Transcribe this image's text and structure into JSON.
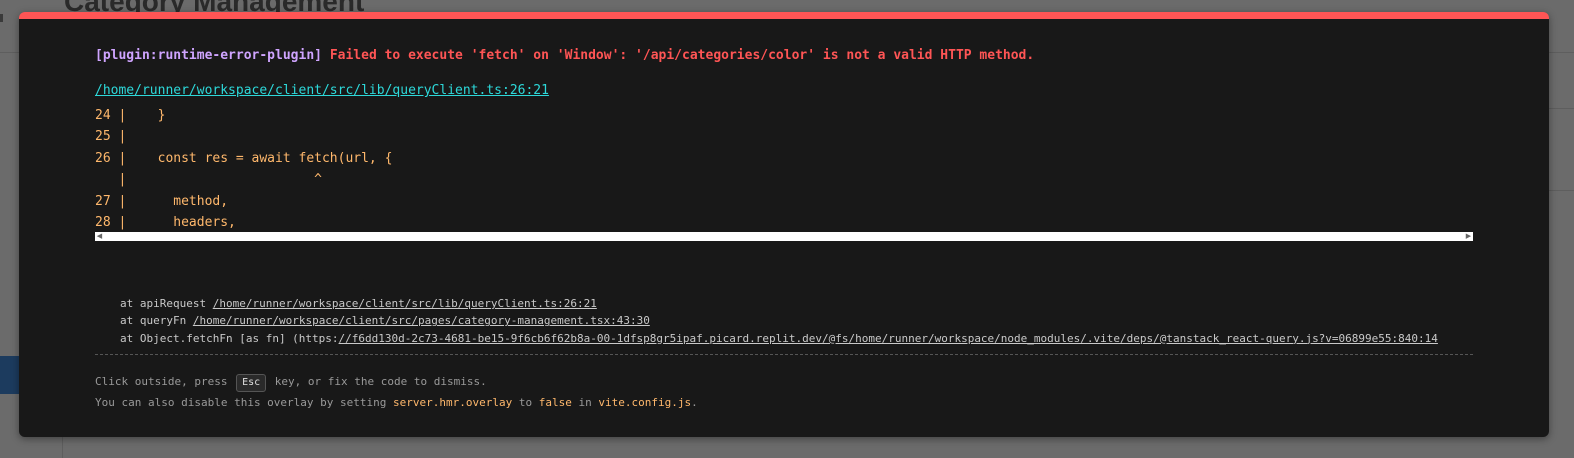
{
  "background": {
    "page_title": "Category Management"
  },
  "overlay": {
    "plugin": "[plugin:runtime-error-plugin]",
    "message": "Failed to execute 'fetch' on 'Window': '/api/categories/color' is not a valid HTTP method.",
    "file": "/home/runner/workspace/client/src/lib/queryClient.ts:26:21",
    "frame": [
      "24 |    }",
      "25 |",
      "26 |    const res = await fetch(url, {",
      "   |                        ^",
      "27 |      method,",
      "28 |      headers,"
    ],
    "stack": [
      {
        "prefix": "at apiRequest ",
        "link": "/home/runner/workspace/client/src/lib/queryClient.ts:26:21",
        "suffix": ""
      },
      {
        "prefix": "at queryFn ",
        "link": "/home/runner/workspace/client/src/pages/category-management.tsx:43:30",
        "suffix": ""
      },
      {
        "prefix": "at Object.fetchFn [as fn] (https:",
        "link": "//f6dd130d-2c73-4681-be15-9f6cb6f62b8a-00-1dfsp8gr5ipaf.picard.replit.dev/@fs/home/runner/workspace/node_modules/.vite/deps/@tanstack_react-query.js?v=06899e55:840:14",
        "suffix": ""
      }
    ],
    "tip": {
      "line1_before": "Click outside, press ",
      "key": "Esc",
      "line1_after": " key, or fix the code to dismiss.",
      "line2_a": "You can also disable this overlay by setting ",
      "line2_code1": "server.hmr.overlay",
      "line2_b": " to ",
      "line2_code2": "false",
      "line2_c": " in ",
      "line2_code3": "vite.config.js",
      "line2_d": "."
    }
  },
  "colors": {
    "accent_red": "#ff5555",
    "plugin_purple": "#cfa4ff",
    "link_cyan": "#2dd9da",
    "code_orange": "#ffb86c"
  }
}
